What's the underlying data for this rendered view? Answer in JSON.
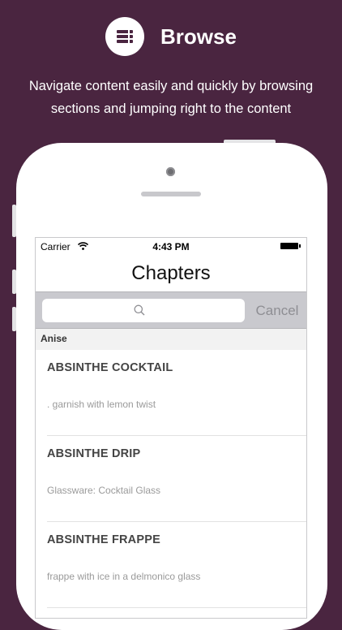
{
  "header": {
    "title": "Browse",
    "icon": "list-menu-icon",
    "tagline_lines": [
      "Navigate content easily and quickly by browsing",
      "sections and jumping right to the content"
    ]
  },
  "status_bar": {
    "carrier": "Carrier",
    "time": "4:43 PM"
  },
  "nav": {
    "title": "Chapters"
  },
  "search": {
    "placeholder": "",
    "cancel_label": "Cancel"
  },
  "section": {
    "title": "Anise"
  },
  "items": [
    {
      "title": "ABSINTHE COCKTAIL",
      "subtitle": ". garnish with lemon twist"
    },
    {
      "title": "ABSINTHE DRIP",
      "subtitle": "Glassware: Cocktail Glass"
    },
    {
      "title": "ABSINTHE FRAPPE",
      "subtitle": "frappe with ice in a delmonico glass"
    }
  ],
  "colors": {
    "background": "#4a2540",
    "search_bar": "#c9c9ce",
    "cancel_text": "#8e8e93"
  }
}
